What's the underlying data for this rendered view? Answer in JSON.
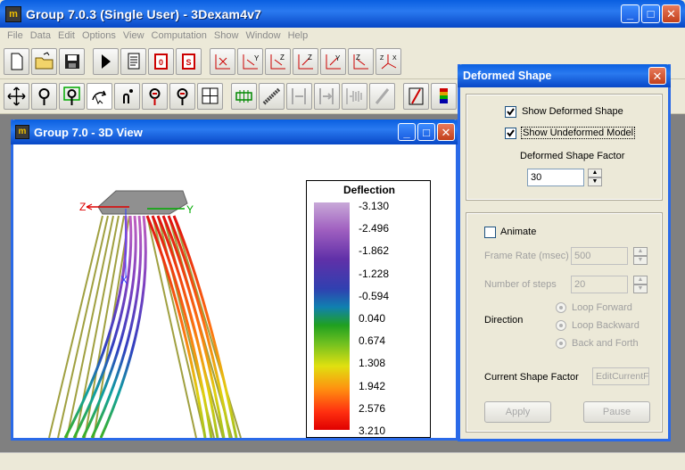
{
  "window": {
    "title": "Group 7.0.3 (Single User) - 3Dexam4v7"
  },
  "menu": [
    "File",
    "Data",
    "Edit",
    "Options",
    "View",
    "Computation",
    "Show",
    "Window",
    "Help"
  ],
  "child": {
    "title": "Group 7.0 - 3D View"
  },
  "axes": {
    "z": "Z",
    "y": "Y",
    "x": "X"
  },
  "legend": {
    "title": "Deflection",
    "values": [
      "-3.130",
      "-2.496",
      "-1.862",
      "-1.228",
      "-0.594",
      "0.040",
      "0.674",
      "1.308",
      "1.942",
      "2.576",
      "3.210"
    ]
  },
  "dialog": {
    "title": "Deformed Shape",
    "show_deformed": "Show Deformed Shape",
    "show_undeformed": "Show Undeformed Model",
    "factor_label": "Deformed Shape Factor",
    "factor_value": "30",
    "animate": "Animate",
    "frame_rate_label": "Frame Rate (msec)",
    "frame_rate_value": "500",
    "steps_label": "Number of steps",
    "steps_value": "20",
    "direction_label": "Direction",
    "loop_forward": "Loop Forward",
    "loop_backward": "Loop Backward",
    "back_forth": "Back and Forth",
    "current_label": "Current Shape Factor",
    "current_value": "EditCurrentF",
    "apply": "Apply",
    "pause": "Pause"
  }
}
